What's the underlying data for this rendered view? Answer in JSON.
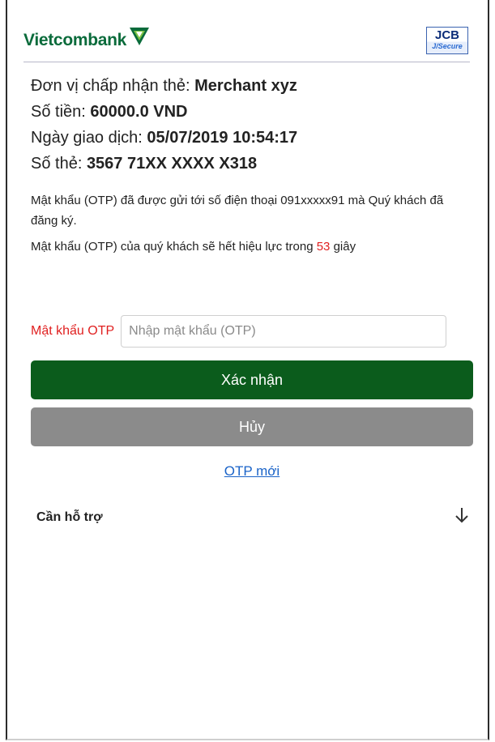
{
  "brand": {
    "logo_text": "Vietcombank",
    "accent_color": "#0a6b3b",
    "badge_top": "JCB",
    "badge_bottom": "J/Secure"
  },
  "transaction": {
    "merchant_label": "Đơn vị chấp nhận thẻ: ",
    "merchant_value": "Merchant xyz",
    "amount_label": "Số tiền: ",
    "amount_value": "60000.0 VND",
    "date_label": "Ngày giao dịch: ",
    "date_value": "05/07/2019 10:54:17",
    "card_label": "Số thẻ: ",
    "card_value": "3567 71XX XXXX X318"
  },
  "notice": {
    "sent_message": "Mật khẩu (OTP) đã được gửi tới số điện thoại 091xxxxx91 mà Quý khách đã đăng ký.",
    "expiry_prefix": "Mật khẩu (OTP) của quý khách sẽ hết hiệu lực trong ",
    "expiry_seconds": "53",
    "expiry_suffix": " giây"
  },
  "otp": {
    "label": "Mật khẩu OTP",
    "value": "",
    "placeholder": "Nhập mật khẩu (OTP)"
  },
  "actions": {
    "confirm_label": "Xác nhận",
    "cancel_label": "Hủy",
    "new_otp_label": "OTP mới",
    "confirm_color": "#0b5c1c",
    "cancel_color": "#8b8b8b"
  },
  "help": {
    "label": "Cần hỗ trợ",
    "icon": "arrow-down-icon"
  }
}
